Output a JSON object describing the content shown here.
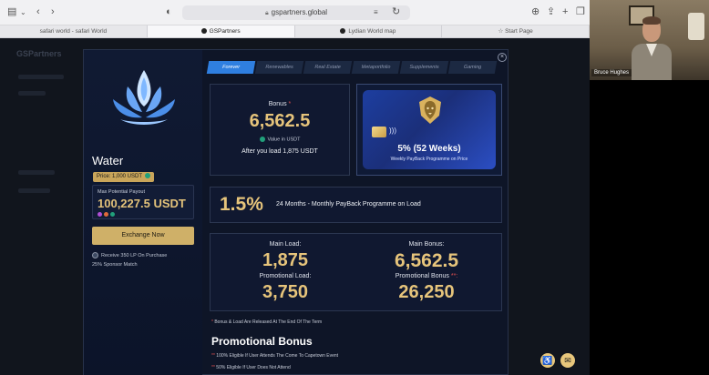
{
  "browser": {
    "url": "gspartners.global",
    "tabs": [
      {
        "label": "safari world - safari World",
        "active": false
      },
      {
        "label": "GSPartners",
        "active": true
      },
      {
        "label": "Lydian World map",
        "active": false
      },
      {
        "label": "Start Page",
        "active": false
      }
    ]
  },
  "background": {
    "brand": "GSPartners"
  },
  "modal": {
    "product": {
      "name": "Water",
      "price": "Price: 1,000 USDT",
      "max_payout_label": "Max Potential Payout",
      "max_payout_value": "100,227.5 USDT",
      "exchange_button": "Exchange Now",
      "receive_text": "Receive 350 LP On Purchase",
      "sponsor_text": "25% Sponsor Match"
    },
    "tabs": [
      {
        "label": "Forever",
        "active": true
      },
      {
        "label": "Renewables",
        "active": false
      },
      {
        "label": "Real Estate",
        "active": false
      },
      {
        "label": "Metaportfolio",
        "active": false
      },
      {
        "label": "Supplements",
        "active": false
      },
      {
        "label": "Gaming",
        "active": false
      }
    ],
    "bonus": {
      "label": "Bonus",
      "star": "*",
      "value": "6,562.5",
      "usdt_note": "Value in USDT",
      "after_load": "After you load 1,875 USDT"
    },
    "promo": {
      "percent": "5% (52 Weeks)",
      "subtitle": "Weekly PayBack Programme on Price"
    },
    "rate": {
      "value": "1.5%",
      "text": "24 Months - Monthly PayBack Programme on Load"
    },
    "load": {
      "main_load_label": "Main Load:",
      "main_load_value": "1,875",
      "promo_load_label": "Promotional Load:",
      "promo_load_value": "3,750",
      "main_bonus_label": "Main Bonus:",
      "main_bonus_value": "6,562.5",
      "promo_bonus_label": "Promotional Bonus",
      "promo_bonus_stars": " **:",
      "promo_bonus_value": "26,250"
    },
    "footnote": "Bonus & Load Are Released At The End Of The Term",
    "promotional_bonus": {
      "title": "Promotional Bonus",
      "lines": [
        "100% Eligible If User Attends The Come To Capetown Event",
        "50% Eligible If User Does Not Attend"
      ]
    }
  },
  "video": {
    "participant_name": "Bruce Hughes"
  },
  "colors": {
    "gold": "#e6c47b",
    "accent_blue": "#2f7fe0",
    "modal_bg": "#0e1527"
  }
}
